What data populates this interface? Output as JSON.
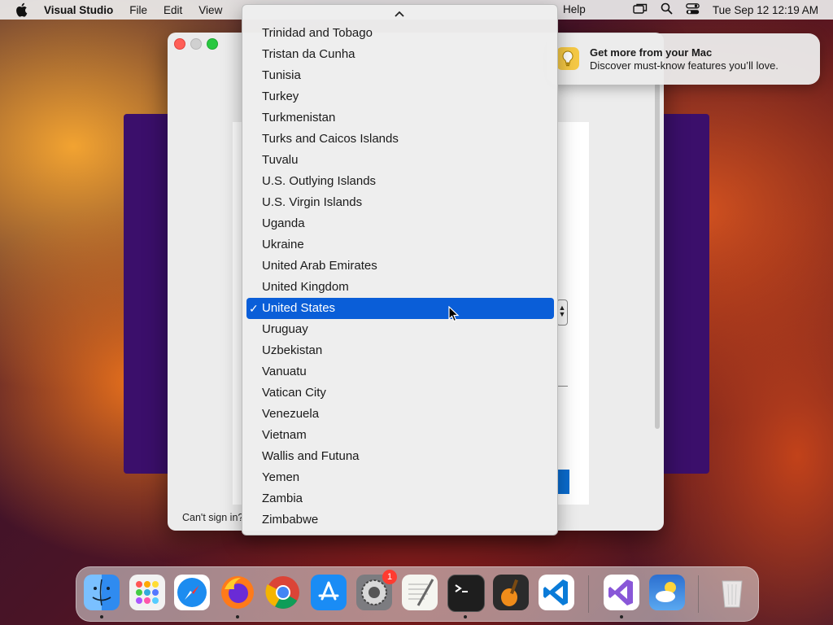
{
  "menubar": {
    "app_name": "Visual Studio",
    "items": [
      "File",
      "Edit",
      "View"
    ],
    "help": "Help",
    "clock": "Tue Sep 12  12:19 AM"
  },
  "notification": {
    "title": "Get more from your Mac",
    "body": "Discover must-know features you’ll love."
  },
  "window": {
    "cant_sign_in": "Can't sign in?"
  },
  "country_popup": {
    "selected": "United States",
    "items": [
      "Trinidad and Tobago",
      "Tristan da Cunha",
      "Tunisia",
      "Turkey",
      "Turkmenistan",
      "Turks and Caicos Islands",
      "Tuvalu",
      "U.S. Outlying Islands",
      "U.S. Virgin Islands",
      "Uganda",
      "Ukraine",
      "United Arab Emirates",
      "United Kingdom",
      "United States",
      "Uruguay",
      "Uzbekistan",
      "Vanuatu",
      "Vatican City",
      "Venezuela",
      "Vietnam",
      "Wallis and Futuna",
      "Yemen",
      "Zambia",
      "Zimbabwe"
    ],
    "check_mark": "✓"
  },
  "dock": {
    "apps": [
      {
        "name": "Finder",
        "icon": "finder-icon",
        "color": "#2f8bf0",
        "running": true
      },
      {
        "name": "Launchpad",
        "icon": "launchpad-icon",
        "color": "#eeeeee",
        "running": false
      },
      {
        "name": "Safari",
        "icon": "safari-icon",
        "color": "#1c8cf0",
        "running": false
      },
      {
        "name": "Firefox",
        "icon": "firefox-icon",
        "color": "#e8641b",
        "running": true
      },
      {
        "name": "Chrome",
        "icon": "chrome-icon",
        "color": "#ffffff",
        "running": false
      },
      {
        "name": "App Store",
        "icon": "app-store-icon",
        "color": "#1a8cf5",
        "running": false
      },
      {
        "name": "System Settings",
        "icon": "system-settings-icon",
        "color": "#8e8e93",
        "running": false,
        "badge": "1"
      },
      {
        "name": "TextEdit",
        "icon": "textedit-icon",
        "color": "#f4f4f0",
        "running": false
      },
      {
        "name": "Terminal",
        "icon": "terminal-icon",
        "color": "#1e1e1e",
        "running": true
      },
      {
        "name": "GarageBand",
        "icon": "garageband-icon",
        "color": "#f08c1a",
        "running": false
      },
      {
        "name": "Visual Studio Code",
        "icon": "vscode-icon",
        "color": "#ffffff",
        "running": false
      },
      {
        "name": "Visual Studio",
        "icon": "visual-studio-icon",
        "color": "#ffffff",
        "running": true
      },
      {
        "name": "Weather",
        "icon": "weather-icon",
        "color": "#3a8be0",
        "running": false
      },
      {
        "name": "Trash",
        "icon": "trash-icon",
        "color": "#e8e8e8",
        "running": false
      }
    ]
  }
}
